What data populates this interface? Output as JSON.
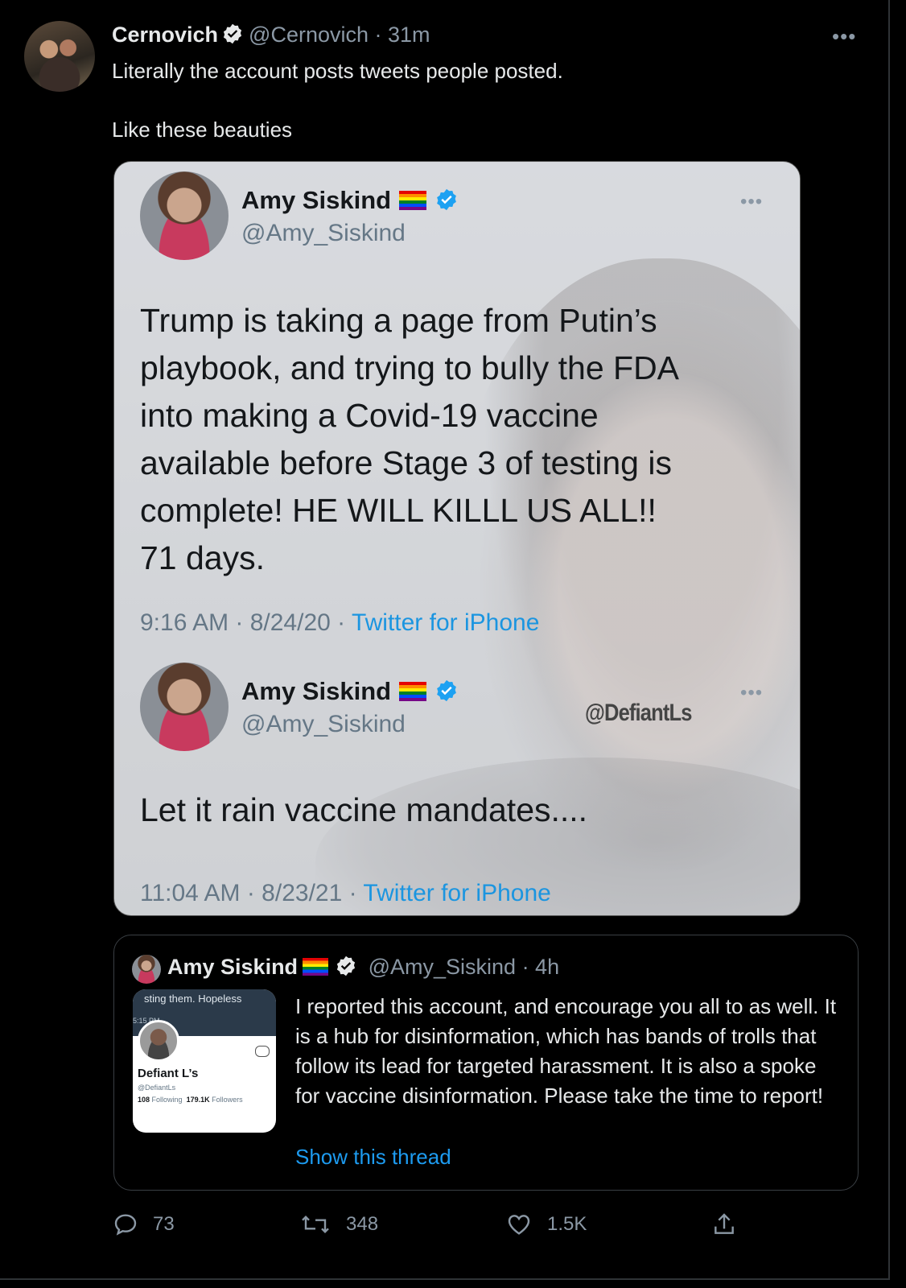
{
  "tweet": {
    "author_name": "Cernovich",
    "author_handle": "@Cernovich",
    "time": "31m",
    "more_label": "•••",
    "text_line1": "Literally the account posts tweets people posted.",
    "text_line2": "Like these beauties"
  },
  "image": {
    "tweet1": {
      "name": "Amy Siskind",
      "handle": "@Amy_Siskind",
      "dots": "•••",
      "body": "Trump is taking a page from Putin’s\nplaybook, and trying to bully the FDA\ninto making a Covid-19 vaccine\navailable before Stage 3 of testing is\ncomplete!   HE WILL KILLL US ALL!!\n71 days.",
      "time": "9:16 AM · 8/24/20 · ",
      "source": "Twitter for iPhone"
    },
    "tweet2": {
      "name": "Amy Siskind",
      "handle": "@Amy_Siskind",
      "dots": "•••",
      "body": "Let it rain vaccine mandates....",
      "time": "11:04 AM · 8/23/21 · ",
      "source": "Twitter for iPhone"
    },
    "watermark": "@DefiantLs"
  },
  "quote": {
    "name": "Amy Siskind",
    "handle": "@Amy_Siskind",
    "time": "· 4h",
    "thumb": {
      "top_text": "sting them. Hopeless",
      "time_text": "5:15 PM",
      "profile_name": "Defiant L’s",
      "profile_handle": "@DefiantLs",
      "following": "108",
      "following_label": "Following",
      "followers": "179.1K",
      "followers_label": "Followers"
    },
    "body": "I reported this account, and encourage you all to as well. It is a hub for disinformation, which has bands of trolls that follow its lead for targeted harassment. It is also a spoke for vaccine disinformation. Please take the time to report!",
    "show_thread": "Show this thread"
  },
  "actions": {
    "replies": "73",
    "retweets": "348",
    "likes": "1.5K"
  },
  "colors": {
    "background": "#000000",
    "link": "#1d9bf0",
    "muted": "#8b98a5",
    "verified": "#1d9bf0"
  }
}
